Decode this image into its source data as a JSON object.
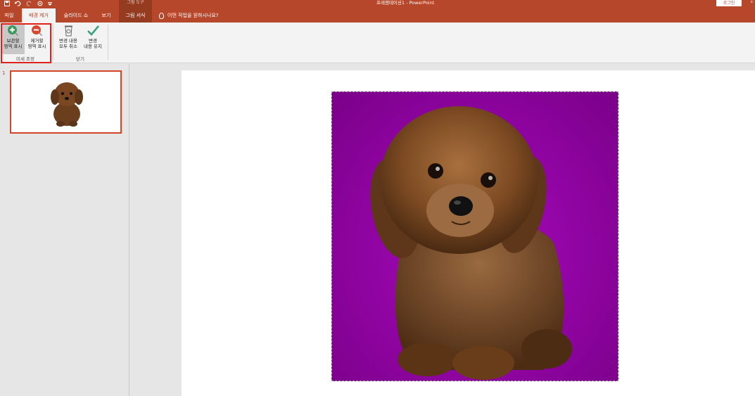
{
  "title_bar": {
    "qat_icons": [
      "save-icon",
      "undo-icon",
      "redo-icon",
      "touch-mode-icon",
      "customize-qat-icon"
    ],
    "context_header": "그림 도구",
    "document_title": "프레젠테이션1  -  PowerPoint",
    "login_label": "로그인",
    "edge_glyph": "ㄷ"
  },
  "tabs": {
    "file": "파일",
    "background_removal": "배경 제거",
    "slideshow": "슬라이드 쇼",
    "view": "보기",
    "picture_format": "그림 서식",
    "tell_me": "어떤 작업을 원하시나요?"
  },
  "ribbon": {
    "mark_keep_line1": "보관할",
    "mark_keep_line2": "영역 표시",
    "mark_remove_line1": "제거할",
    "mark_remove_line2": "영역 표시",
    "refine_group": "미세 조정",
    "discard_line1": "변경 내용",
    "discard_line2": "모두 취소",
    "keep_changes_line1": "변경",
    "keep_changes_line2": "내용 유지",
    "close_group": "닫기"
  },
  "thumbnails": [
    {
      "number": "1"
    }
  ],
  "colors": {
    "accent": "#b7472a",
    "contextual_tab": "#953b20",
    "highlight": "#e0201a",
    "picture_background": "#9305a6"
  }
}
